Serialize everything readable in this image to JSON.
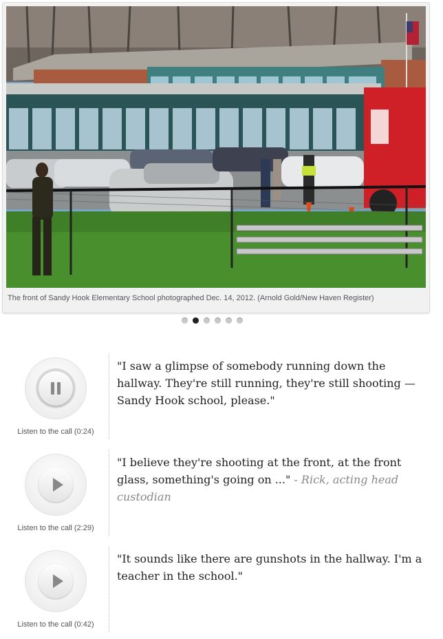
{
  "gallery": {
    "caption": "The front of Sandy Hook Elementary School photographed Dec. 14, 2012. (Arnold Gold/New Haven Register)",
    "dots_total": 6,
    "active_dot": 2
  },
  "calls": [
    {
      "state": "pause",
      "listen_label": "Listen to the call (0:24)",
      "quote": "\"I saw a glimpse of somebody running down the hallway. They're still running, they're still shooting — Sandy Hook school, please.\"",
      "attribution": ""
    },
    {
      "state": "play",
      "listen_label": "Listen to the call (2:29)",
      "quote": "\"I believe they're shooting at the front, at the front glass, something's going on ...\"",
      "attribution": " - Rick, acting head custodian"
    },
    {
      "state": "play",
      "listen_label": "Listen to the call (0:42)",
      "quote": "\"It sounds like there are gunshots in the hallway. I'm a teacher in the school.\"",
      "attribution": ""
    }
  ]
}
